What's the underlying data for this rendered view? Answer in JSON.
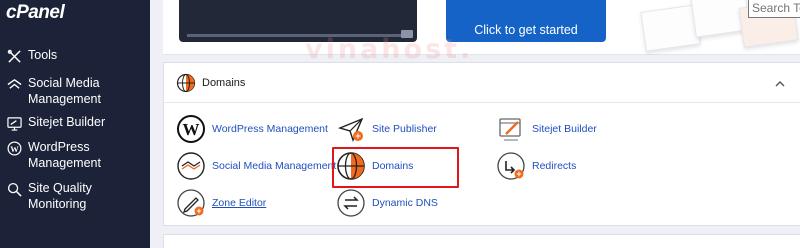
{
  "sidebar": {
    "logo": "cPanel",
    "items": [
      {
        "label": "Tools",
        "icon": "tools-icon"
      },
      {
        "label": "Social Media Management",
        "icon": "social-media-icon"
      },
      {
        "label": "Sitejet Builder",
        "icon": "sitejet-icon"
      },
      {
        "label": "WordPress Management",
        "icon": "wordpress-icon"
      },
      {
        "label": "Site Quality Monitoring",
        "icon": "site-quality-icon"
      }
    ]
  },
  "search": {
    "placeholder": "Search Tools"
  },
  "banner": {
    "cta_label": "Click to get started"
  },
  "domains_panel": {
    "title": "Domains",
    "tools": [
      {
        "label": "WordPress Management",
        "icon": "wordpress-icon"
      },
      {
        "label": "Site Publisher",
        "icon": "site-publisher-icon"
      },
      {
        "label": "Sitejet Builder",
        "icon": "sitejet-builder-icon"
      },
      {
        "label": "Social Media Management",
        "icon": "social-media-management-icon"
      },
      {
        "label": "Domains",
        "icon": "domains-globe-icon"
      },
      {
        "label": "Redirects",
        "icon": "redirects-icon"
      },
      {
        "label": "Zone Editor",
        "icon": "zone-editor-icon"
      },
      {
        "label": "Dynamic DNS",
        "icon": "dynamic-dns-icon"
      }
    ]
  },
  "watermark": "vinahost.",
  "colors": {
    "sidebar_bg": "#1c2238",
    "accent_blue": "#1663c7",
    "link_blue": "#1f4fbf",
    "highlight_red": "#e0161b",
    "domains_orange": "#f26a1b"
  }
}
